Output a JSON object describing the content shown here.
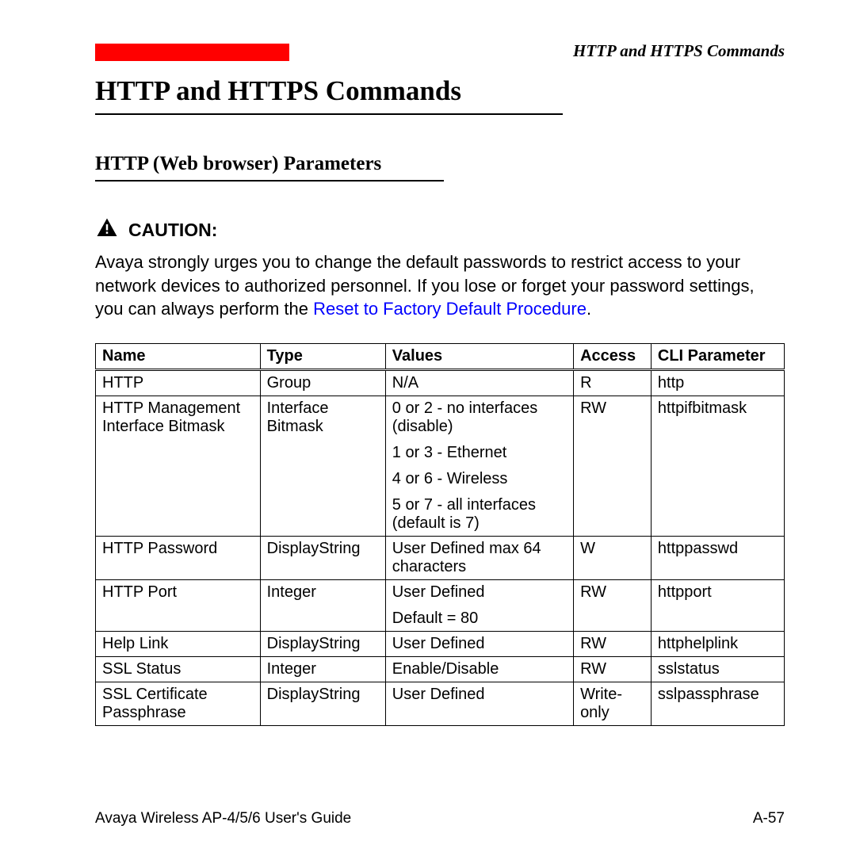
{
  "header": {
    "right_text": "HTTP and HTTPS Commands"
  },
  "title": "HTTP and HTTPS Commands",
  "subtitle": "HTTP (Web browser) Parameters",
  "caution": {
    "label": "CAUTION:",
    "text_before_link": "Avaya strongly urges you to change the default passwords to restrict access to your network devices to authorized personnel. If you lose or forget your password settings, you can always perform the ",
    "link_text": "Reset to Factory Default Procedure",
    "text_after_link": "."
  },
  "table": {
    "headers": {
      "name": "Name",
      "type": "Type",
      "values": "Values",
      "access": "Access",
      "cli": "CLI Parameter"
    },
    "rows": [
      {
        "name": "HTTP",
        "type": "Group",
        "values": [
          "N/A"
        ],
        "access": "R",
        "cli": "http"
      },
      {
        "name": "HTTP Management Interface Bitmask",
        "type": "Interface Bitmask",
        "values": [
          "0 or 2 - no interfaces (disable)",
          "1 or 3 - Ethernet",
          "4 or 6 - Wireless",
          "5 or 7 - all interfaces (default is 7)"
        ],
        "access": "RW",
        "cli": "httpifbitmask"
      },
      {
        "name": "HTTP Password",
        "type": "DisplayString",
        "values": [
          "User Defined max 64 characters"
        ],
        "access": "W",
        "cli": "httppasswd"
      },
      {
        "name": "HTTP Port",
        "type": "Integer",
        "values": [
          "User Defined",
          "Default = 80"
        ],
        "access": "RW",
        "cli": "httpport"
      },
      {
        "name": "Help Link",
        "type": "DisplayString",
        "values": [
          "User Defined"
        ],
        "access": "RW",
        "cli": "httphelplink"
      },
      {
        "name": "SSL Status",
        "type": "Integer",
        "values": [
          "Enable/Disable"
        ],
        "access": "RW",
        "cli": "sslstatus"
      },
      {
        "name": "SSL Certificate Passphrase",
        "type": "DisplayString",
        "values": [
          "User Defined"
        ],
        "access": "Write-only",
        "cli": "sslpassphrase"
      }
    ]
  },
  "footer": {
    "left": "Avaya Wireless AP-4/5/6 User's Guide",
    "right": "A-57"
  }
}
